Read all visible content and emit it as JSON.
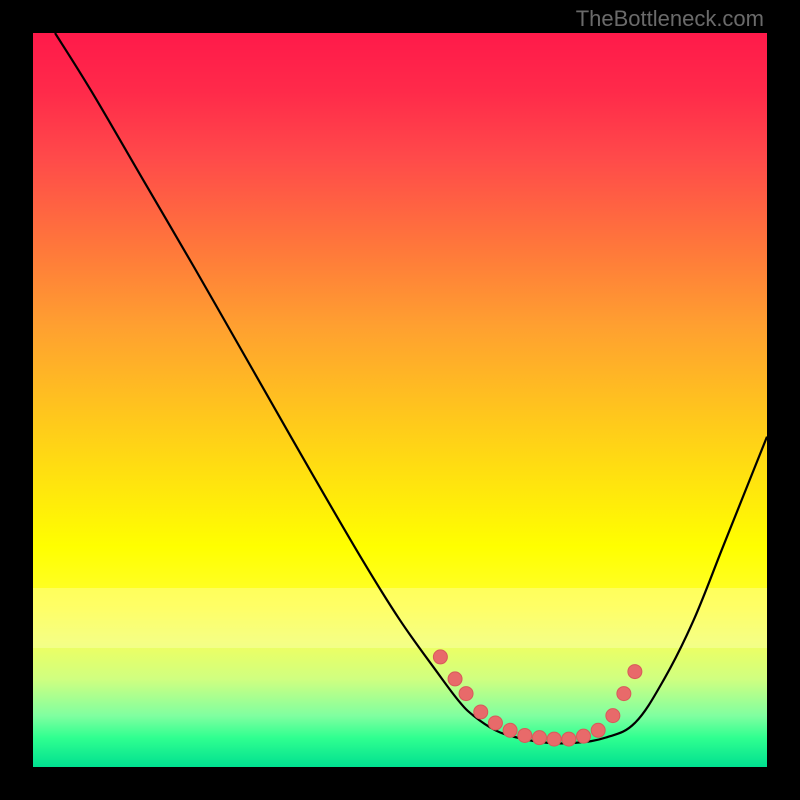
{
  "attribution": "TheBottleneck.com",
  "colors": {
    "background": "#000000",
    "curve": "#000000",
    "marker_fill": "#e86a6a",
    "marker_stroke": "#d85a5a"
  },
  "chart_data": {
    "type": "line",
    "title": "",
    "xlabel": "",
    "ylabel": "",
    "xlim": [
      0,
      100
    ],
    "ylim": [
      0,
      100
    ],
    "series": [
      {
        "name": "curve",
        "x": [
          3,
          8,
          15,
          22,
          30,
          38,
          45,
          50,
          55,
          58,
          60,
          63,
          66,
          70,
          74,
          78,
          82,
          86,
          90,
          94,
          98,
          100
        ],
        "values": [
          100,
          92,
          80,
          68,
          54,
          40,
          28,
          20,
          13,
          9,
          7,
          5,
          4,
          3.3,
          3.3,
          4,
          6,
          12,
          20,
          30,
          40,
          45
        ]
      }
    ],
    "markers": {
      "x": [
        55.5,
        57.5,
        59,
        61,
        63,
        65,
        67,
        69,
        71,
        73,
        75,
        77,
        79,
        80.5,
        82
      ],
      "values": [
        15,
        12,
        10,
        7.5,
        6,
        5,
        4.3,
        4,
        3.8,
        3.8,
        4.2,
        5,
        7,
        10,
        13
      ]
    }
  }
}
